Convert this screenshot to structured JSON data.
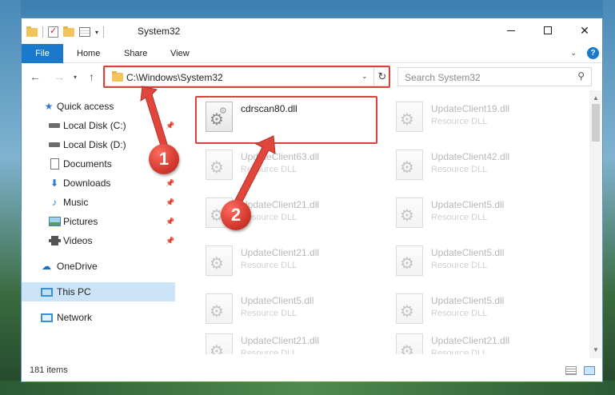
{
  "window": {
    "title": "System32"
  },
  "ribbon": {
    "file": "File",
    "home": "Home",
    "share": "Share",
    "view": "View"
  },
  "address": {
    "path": "C:\\Windows\\System32"
  },
  "search": {
    "placeholder": "Search System32"
  },
  "sidebar": {
    "items": [
      {
        "label": "Quick access"
      },
      {
        "label": "Local Disk (C:)"
      },
      {
        "label": "Local Disk (D:)"
      },
      {
        "label": "Documents"
      },
      {
        "label": "Downloads"
      },
      {
        "label": "Music"
      },
      {
        "label": "Pictures"
      },
      {
        "label": "Videos"
      },
      {
        "label": "OneDrive"
      },
      {
        "label": "This PC"
      },
      {
        "label": "Network"
      }
    ]
  },
  "files": [
    {
      "name": "cdrscan80.dll",
      "type": ""
    },
    {
      "name": "UpdateClient19.dll",
      "type": "Resource DLL"
    },
    {
      "name": "UpdateClient63.dll",
      "type": "Resource DLL"
    },
    {
      "name": "UpdateClient42.dll",
      "type": "Resource DLL"
    },
    {
      "name": "UpdateClient21.dll",
      "type": "Resource DLL"
    },
    {
      "name": "UpdateClient5.dll",
      "type": "Resource DLL"
    },
    {
      "name": "UpdateClient21.dll",
      "type": "Resource DLL"
    },
    {
      "name": "UpdateClient5.dll",
      "type": "Resource DLL"
    },
    {
      "name": "UpdateClient5.dll",
      "type": "Resource DLL"
    },
    {
      "name": "UpdateClient5.dll",
      "type": "Resource DLL"
    },
    {
      "name": "UpdateClient21.dll",
      "type": "Resource DLL"
    },
    {
      "name": "UpdateClient21.dll",
      "type": "Resource DLL"
    }
  ],
  "status": {
    "count": "181 items"
  },
  "callouts": {
    "one": "1",
    "two": "2"
  },
  "colors": {
    "accent": "#1979ca",
    "highlight": "#d9433b",
    "selection": "#cce4f7"
  },
  "icons": {
    "quick_access": "star-icon",
    "disk": "disk-icon",
    "documents": "document-icon",
    "downloads": "download-arrow-icon",
    "music": "music-note-icon",
    "pictures": "pictures-icon",
    "videos": "videos-icon",
    "onedrive": "cloud-icon",
    "this_pc": "computer-icon",
    "network": "network-icon",
    "file": "dll-gear-icon"
  }
}
